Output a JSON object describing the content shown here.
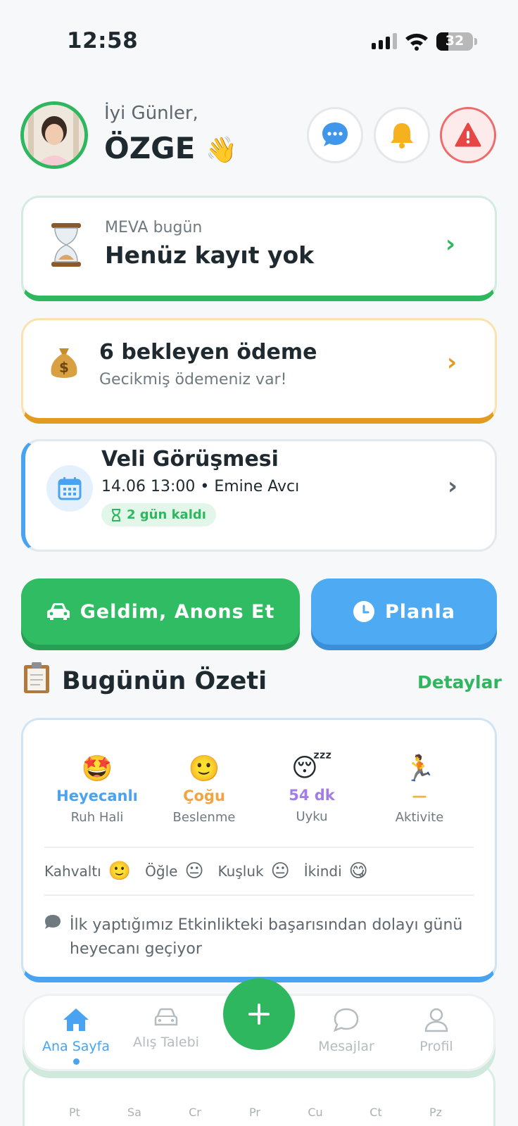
{
  "status_bar": {
    "time": "12:58",
    "battery": "32"
  },
  "header": {
    "greeting": "İyi Günler,",
    "name": "ÖZGE",
    "wave_emoji": "👋"
  },
  "meva_card": {
    "subtitle": "MEVA bugün",
    "title": "Henüz kayıt yok",
    "icon": "hourglass-icon"
  },
  "payment_card": {
    "title": "6 bekleyen ödeme",
    "subtitle": "Gecikmiş ödemeniz var!",
    "icon": "money-bag-icon"
  },
  "meeting_card": {
    "title": "Veli Görüşmesi",
    "detail": "14.06 13:00 • Emine Avcı",
    "badge": "2 gün kaldı"
  },
  "actions": {
    "arrive_label": "Geldim, Anons Et",
    "plan_label": "Planla"
  },
  "summary": {
    "title": "Bugünün Özeti",
    "details_link": "Detaylar",
    "stats": [
      {
        "emoji": "🤩",
        "value": "Heyecanlı",
        "label": "Ruh Hali",
        "color": "#4aa3f0"
      },
      {
        "emoji": "🙂",
        "value": "Çoğu",
        "label": "Beslenme",
        "color": "#f3a340"
      },
      {
        "emoji": "😴",
        "value": "54 dk",
        "label": "Uyku",
        "color": "#a27de6"
      },
      {
        "emoji": "🏃",
        "value": "—",
        "label": "Aktivite",
        "color": "#f3b23e"
      }
    ],
    "meals": [
      {
        "label": "Kahvaltı",
        "emoji": "🙂"
      },
      {
        "label": "Öğle",
        "emoji": "😐"
      },
      {
        "label": "Kuşluk",
        "emoji": "😐"
      },
      {
        "label": "İkindi",
        "emoji": "😋"
      }
    ],
    "note": "İlk yaptığımız Etkinlikteki başarısından dolayı günü heyecanı geçiyor"
  },
  "nav": {
    "items": [
      {
        "label": "Ana Sayfa",
        "icon": "home-icon"
      },
      {
        "label": "Alış Talebi",
        "icon": "car-icon"
      },
      {
        "label": "Mesajlar",
        "icon": "chat-icon"
      },
      {
        "label": "Profil",
        "icon": "person-icon"
      }
    ],
    "fab_icon": "plus-icon"
  },
  "week_days": [
    "Pt",
    "Sa",
    "Cr",
    "Pr",
    "Cu",
    "Ct",
    "Pz"
  ]
}
